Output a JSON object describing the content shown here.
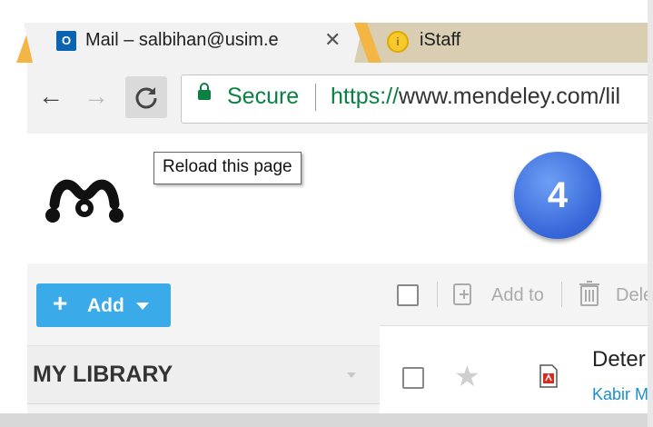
{
  "browser": {
    "tabs": [
      {
        "title": "Mail – salbihan@usim.e",
        "icon": "outlook-icon",
        "close": "✕"
      },
      {
        "title": "iStaff",
        "icon": "istaff-icon"
      }
    ],
    "nav": {
      "back": "←",
      "forward": "→",
      "reload": "C"
    },
    "omnibox": {
      "secure_label": "Secure",
      "url_scheme": "https://",
      "url_rest": "www.mendeley.com/lil"
    },
    "tooltip": "Reload this page"
  },
  "page": {
    "logo": "mendeley-logo",
    "step_badge": "4",
    "sidebar": {
      "add_button": {
        "plus": "+",
        "label": "Add"
      },
      "library_label": "MY LIBRARY"
    },
    "toolbar": {
      "add_to_label": "Add to",
      "delete_label": "Dele"
    },
    "document": {
      "title": "Deter",
      "author": "Kabir M"
    }
  },
  "colors": {
    "accent_blue": "#3aabe8",
    "secure_green": "#0b8043",
    "badge_blue": "#3565d8",
    "tab_bar": "#d9cdb2"
  }
}
